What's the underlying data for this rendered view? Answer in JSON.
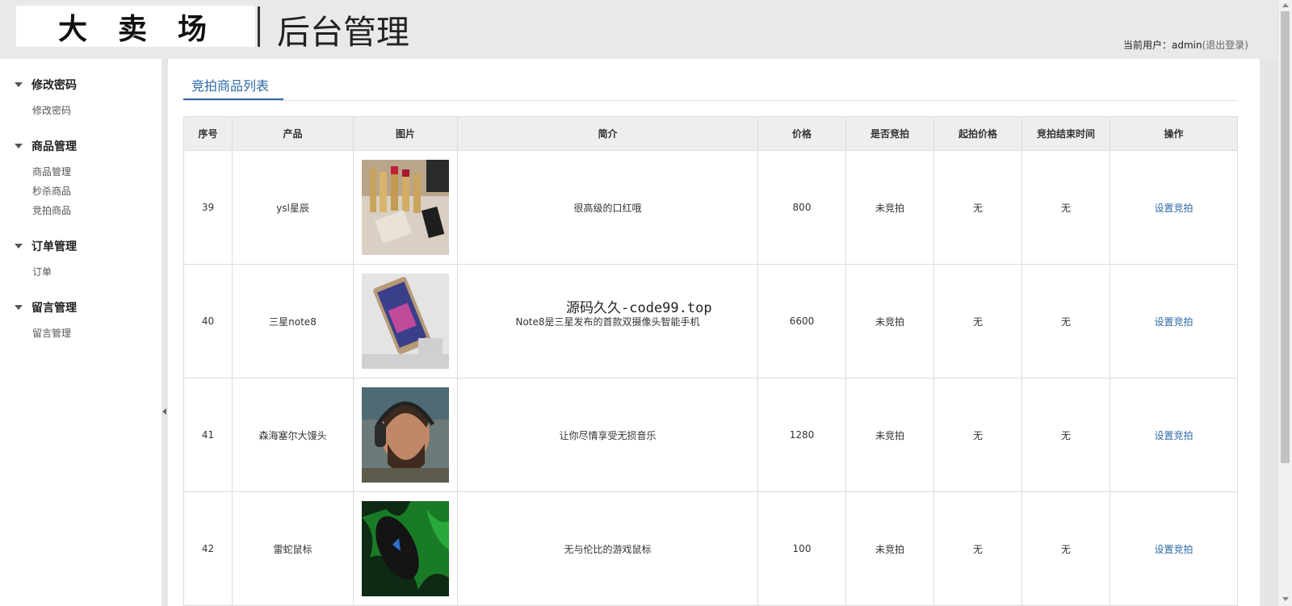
{
  "header": {
    "logo": "大卖场",
    "title": "后台管理",
    "user_prefix": "当前用户：",
    "user_name": "admin",
    "logout": "(退出登录)"
  },
  "sidebar": {
    "sections": [
      {
        "title": "修改密码",
        "items": [
          "修改密码"
        ]
      },
      {
        "title": "商品管理",
        "items": [
          "商品管理",
          "秒杀商品",
          "竞拍商品"
        ]
      },
      {
        "title": "订单管理",
        "items": [
          "订单"
        ]
      },
      {
        "title": "留言管理",
        "items": [
          "留言管理"
        ]
      }
    ]
  },
  "main": {
    "tab_title": "竞拍商品列表",
    "columns": [
      "序号",
      "产品",
      "图片",
      "简介",
      "价格",
      "是否竞拍",
      "起拍价格",
      "竞拍结束时间",
      "操作"
    ],
    "rows": [
      {
        "id": "39",
        "product": "ysl星辰",
        "image": "lipstick-photo",
        "desc": "很高级的口红哦",
        "price": "800",
        "auction": "未竞拍",
        "start_price": "无",
        "end_time": "无",
        "action": "设置竞拍"
      },
      {
        "id": "40",
        "product": "三星note8",
        "image": "phone-photo",
        "desc": "Note8是三星发布的首款双摄像头智能手机",
        "price": "6600",
        "auction": "未竞拍",
        "start_price": "无",
        "end_time": "无",
        "action": "设置竞拍"
      },
      {
        "id": "41",
        "product": "森海塞尔大馒头",
        "image": "headphones-photo",
        "desc": "让你尽情享受无损音乐",
        "price": "1280",
        "auction": "未竞拍",
        "start_price": "无",
        "end_time": "无",
        "action": "设置竞拍"
      },
      {
        "id": "42",
        "product": "雷蛇鼠标",
        "image": "mouse-photo",
        "desc": "无与伦比的游戏鼠标",
        "price": "100",
        "auction": "未竞拍",
        "start_price": "无",
        "end_time": "无",
        "action": "设置竞拍"
      }
    ]
  },
  "watermark": "源码久久-code99.top",
  "colors": {
    "accent": "#2c6aa5",
    "header_bg": "#e9e9e9",
    "table_head_bg": "#eeeeee"
  }
}
